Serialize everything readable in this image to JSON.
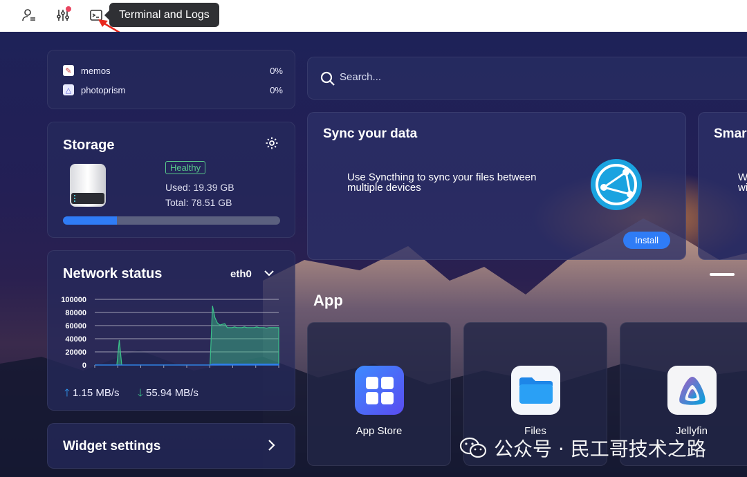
{
  "topbar": {
    "icons": [
      "user-settings-icon",
      "sliders-icon",
      "terminal-icon"
    ],
    "tooltip": "Terminal and Logs"
  },
  "apps_usage": [
    {
      "name": "memos",
      "percent": "0%"
    },
    {
      "name": "photoprism",
      "percent": "0%"
    }
  ],
  "storage": {
    "title": "Storage",
    "status": "Healthy",
    "used": "Used: 19.39 GB",
    "total": "Total: 78.51 GB",
    "used_fraction": 0.247
  },
  "network": {
    "title": "Network status",
    "interface": "eth0",
    "upload": "1.15 MB/s",
    "download": "55.94 MB/s"
  },
  "chart_data": {
    "type": "area",
    "yticks": [
      "100000",
      "80000",
      "60000",
      "40000",
      "20000",
      "0"
    ],
    "ylim": [
      0,
      100000
    ],
    "series": [
      {
        "values": [
          0,
          0,
          0,
          0,
          0,
          0,
          0,
          0,
          0,
          0,
          38000,
          0,
          0,
          0,
          0,
          0,
          0,
          0,
          0,
          0,
          0,
          0,
          0,
          0,
          0,
          0,
          0,
          0,
          0,
          0,
          0,
          0,
          0,
          0,
          0,
          0,
          0,
          0,
          0,
          0,
          0,
          0,
          0,
          0,
          0,
          0,
          0,
          0,
          90000,
          72000,
          64000,
          61000,
          62000,
          63000,
          57000,
          57000,
          57000,
          58000,
          57000,
          57000,
          57000,
          58000,
          57000,
          57000,
          57000,
          57000,
          58000,
          57000,
          57000,
          57000,
          56000,
          57000,
          57000,
          57000,
          57000,
          57000
        ]
      },
      {
        "values": [
          0,
          0,
          0,
          0,
          0,
          0,
          0,
          0,
          0,
          0,
          0,
          0,
          0,
          0,
          0,
          0,
          0,
          0,
          0,
          0,
          0,
          0,
          0,
          0,
          0,
          0,
          0,
          0,
          0,
          0,
          0,
          0,
          0,
          0,
          0,
          0,
          0,
          0,
          0,
          0,
          0,
          0,
          0,
          0,
          0,
          0,
          0,
          0,
          1500,
          1500,
          1500,
          1500,
          1500,
          1500,
          1500,
          1500,
          1500,
          1500,
          1500,
          1500,
          1500,
          1500,
          1500,
          1500,
          1500,
          1500,
          1500,
          1500,
          1500,
          1500,
          1500,
          1500,
          1500,
          1500,
          1500,
          1500
        ]
      }
    ],
    "colors": [
      "#3bc28a",
      "#2f7cf6"
    ]
  },
  "widget_settings": {
    "label": "Widget settings"
  },
  "search": {
    "placeholder": "Search..."
  },
  "sync_card": {
    "title": "Sync your data",
    "description": "Use Syncthing to sync your files between multiple devices",
    "button": "Install"
  },
  "next_card": {
    "title": "Smar",
    "text1": "W",
    "text2": "wi"
  },
  "app_section": {
    "title": "App"
  },
  "apps": [
    {
      "name": "App Store"
    },
    {
      "name": "Files"
    },
    {
      "name": "Jellyfin"
    }
  ],
  "watermark": {
    "text": "公众号 · 民工哥技术之路"
  }
}
